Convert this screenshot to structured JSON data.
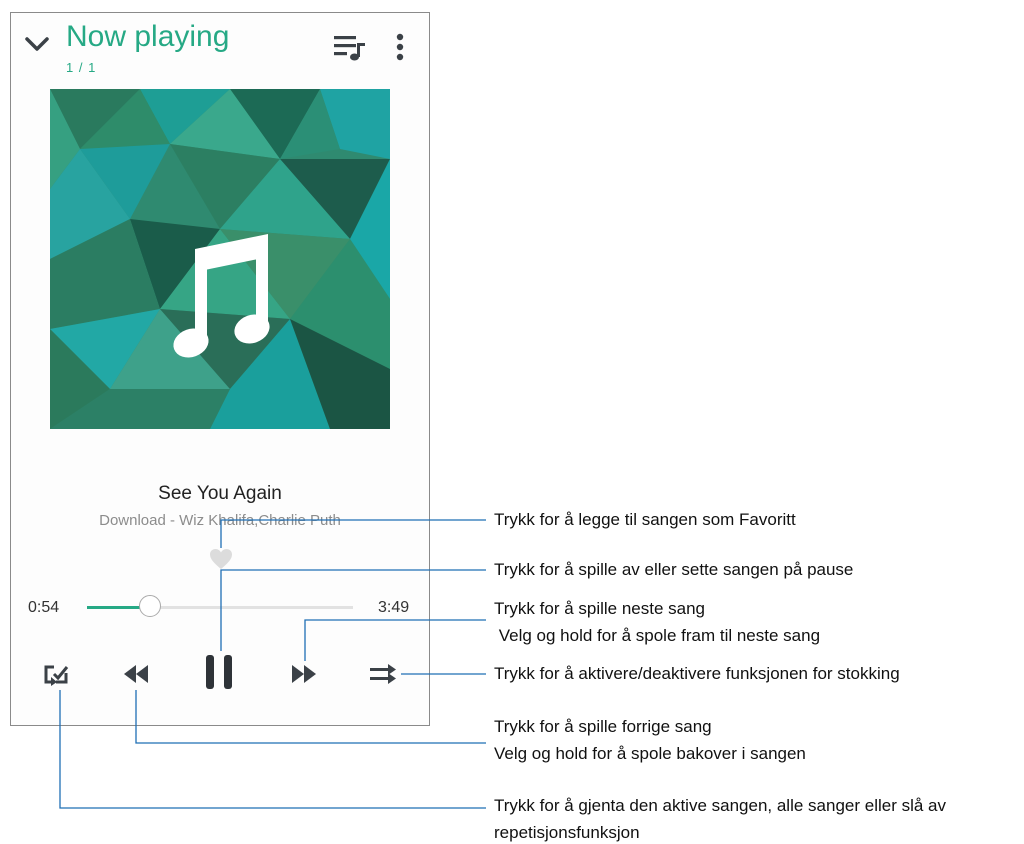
{
  "header": {
    "title": "Now playing",
    "queue_position": "1 / 1"
  },
  "track": {
    "title": "See You Again",
    "subtitle": "Download - Wiz Khalifa,Charlie Puth"
  },
  "playback": {
    "elapsed": "0:54",
    "duration": "3:49",
    "progress": 0.236
  },
  "icons": {
    "collapse": "chevron-down-icon",
    "queue": "playlist-icon",
    "menu": "more-vert-icon",
    "artwork": "music-note-icon",
    "favorite": "heart-icon",
    "repeat": "repeat-icon",
    "previous": "rewind-icon",
    "play_pause": "pause-icon",
    "next": "fast-forward-icon",
    "shuffle": "shuffle-icon"
  },
  "colors": {
    "accent": "#26a985",
    "icon": "#3b4147",
    "callout_line": "#1f6fb5"
  },
  "callouts": {
    "favorite": "Trykk for å legge til sangen som Favoritt",
    "play_pause": "Trykk for å spille av eller sette sangen på pause",
    "next_line1": "Trykk for å spille neste sang",
    "next_line2": " Velg og hold for å spole fram til neste sang",
    "shuffle": "Trykk for å aktivere/deaktivere funksjonen for stokking",
    "previous_line1": "Trykk for å spille forrige sang",
    "previous_line2": "Velg og hold for å spole bakover i sangen",
    "repeat_line1": "Trykk for å gjenta den aktive sangen, alle sanger eller slå av",
    "repeat_line2": "repetisjonsfunksjon"
  }
}
